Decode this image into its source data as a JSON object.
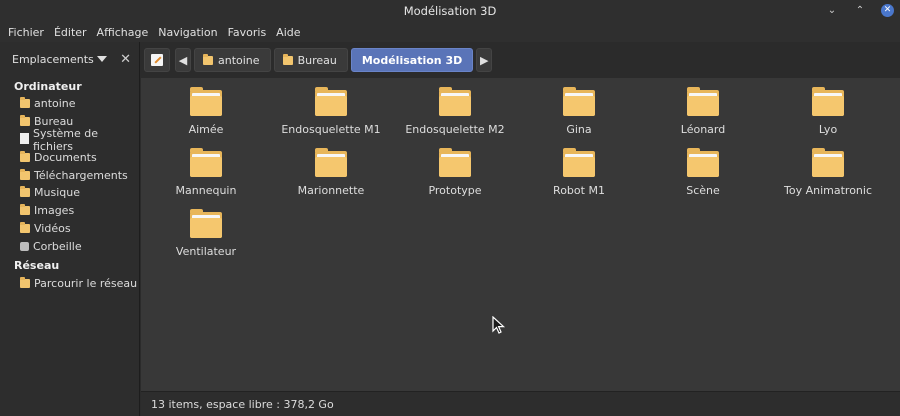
{
  "window": {
    "title": "Modélisation 3D"
  },
  "menubar": {
    "items": [
      "Fichier",
      "Éditer",
      "Affichage",
      "Navigation",
      "Favoris",
      "Aide"
    ]
  },
  "sidebar": {
    "header_label": "Emplacements",
    "sections": [
      {
        "title": "Ordinateur",
        "items": [
          {
            "label": "antoine",
            "icon": "home-folder-icon"
          },
          {
            "label": "Bureau",
            "icon": "desktop-folder-icon"
          },
          {
            "label": "Système de fichiers",
            "icon": "filesystem-icon"
          },
          {
            "label": "Documents",
            "icon": "documents-folder-icon"
          },
          {
            "label": "Téléchargements",
            "icon": "downloads-folder-icon"
          },
          {
            "label": "Musique",
            "icon": "music-folder-icon"
          },
          {
            "label": "Images",
            "icon": "pictures-folder-icon"
          },
          {
            "label": "Vidéos",
            "icon": "videos-folder-icon"
          },
          {
            "label": "Corbeille",
            "icon": "trash-icon"
          }
        ]
      },
      {
        "title": "Réseau",
        "items": [
          {
            "label": "Parcourir le réseau",
            "icon": "network-folder-icon"
          }
        ]
      }
    ]
  },
  "breadcrumb": {
    "items": [
      "antoine",
      "Bureau",
      "Modélisation 3D"
    ],
    "active_index": 2
  },
  "files": [
    "Aimée",
    "Endosquelette M1",
    "Endosquelette M2",
    "Gina",
    "Léonard",
    "Lyo",
    "Mannequin",
    "Marionnette",
    "Prototype",
    "Robot M1",
    "Scène",
    "Toy Animatronic",
    "Ventilateur"
  ],
  "statusbar": {
    "text": "13 items, espace libre : 378,2 Go"
  },
  "colors": {
    "accent": "#5a74b8",
    "folder": "#f5c76e",
    "close_button": "#4a77cc"
  }
}
